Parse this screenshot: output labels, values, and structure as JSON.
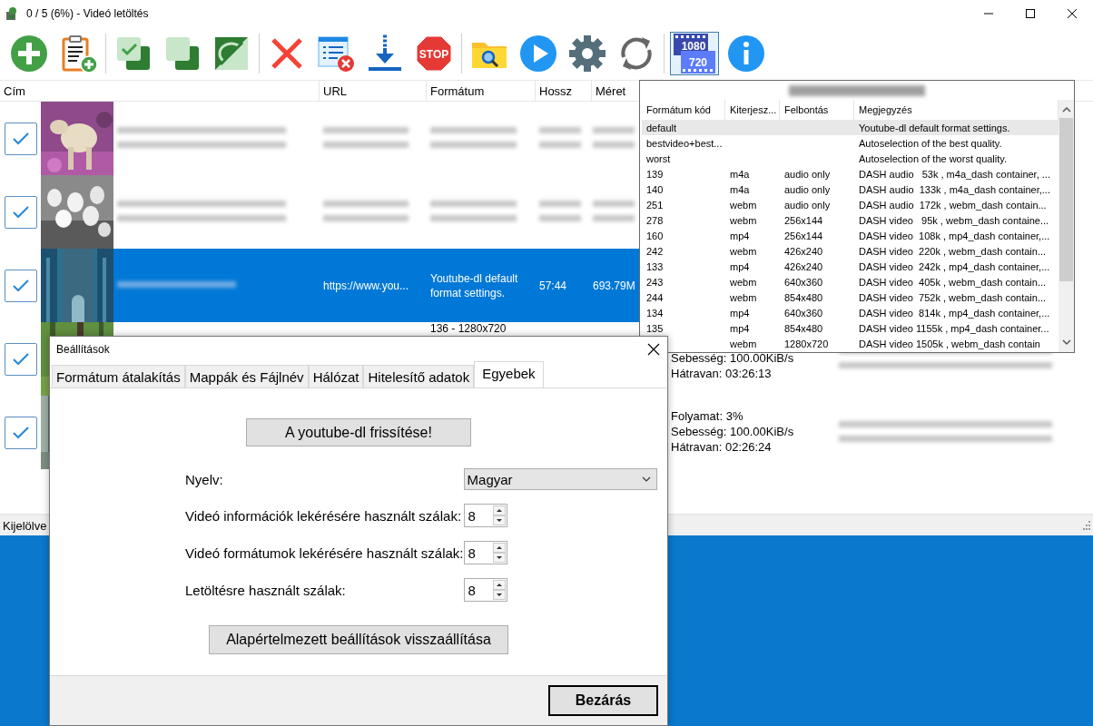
{
  "window": {
    "title": "0 / 5 (6%) - Videó letöltés"
  },
  "toolbar": [
    {
      "kind": "add",
      "selected": false
    },
    {
      "kind": "paste",
      "selected": false
    },
    {
      "kind": "sep"
    },
    {
      "kind": "checkall",
      "selected": false
    },
    {
      "kind": "uncheckall",
      "selected": false
    },
    {
      "kind": "invert",
      "selected": false
    },
    {
      "kind": "sep"
    },
    {
      "kind": "delete",
      "selected": false
    },
    {
      "kind": "removelist",
      "selected": false
    },
    {
      "kind": "download",
      "selected": false
    },
    {
      "kind": "stop",
      "label": "STOP",
      "selected": false
    },
    {
      "kind": "sep"
    },
    {
      "kind": "folder",
      "selected": false
    },
    {
      "kind": "play",
      "selected": false
    },
    {
      "kind": "settings",
      "selected": false
    },
    {
      "kind": "refresh",
      "selected": false
    },
    {
      "kind": "sep"
    },
    {
      "kind": "quality",
      "labels": [
        "1080",
        "720"
      ],
      "selected": true
    },
    {
      "kind": "info",
      "selected": false
    }
  ],
  "table": {
    "columns": [
      "Cím",
      "URL",
      "Formátum",
      "Hossz",
      "Méret"
    ],
    "rows": [
      {
        "checked": true,
        "selected": false,
        "cells": [
          {
            "kind": "redacted"
          },
          {
            "kind": "redacted"
          },
          {
            "kind": "redacted"
          },
          {
            "kind": "redacted"
          },
          {
            "kind": "redacted"
          }
        ]
      },
      {
        "checked": true,
        "selected": false,
        "cells": [
          {
            "kind": "redacted"
          },
          {
            "kind": "redacted"
          },
          {
            "kind": "redacted"
          },
          {
            "kind": "redacted"
          },
          {
            "kind": "redacted"
          }
        ]
      },
      {
        "checked": true,
        "selected": true,
        "cells": [
          {
            "kind": "redacted"
          },
          {
            "kind": "text",
            "text": "https://www.you..."
          },
          {
            "kind": "text",
            "text": "Youtube-dl default format settings."
          },
          {
            "kind": "text",
            "text": "57:44"
          },
          {
            "kind": "text",
            "text": "693.79M"
          }
        ]
      },
      {
        "checked": true,
        "selected": false,
        "cells": [
          {
            "kind": "empty"
          },
          {
            "kind": "empty"
          },
          {
            "kind": "text",
            "text": "136 - 1280x720"
          },
          {
            "kind": "empty"
          },
          {
            "kind": "empty"
          },
          {
            "kind": "lines",
            "lines": [
              "Sebesség: 100.00KiB/s",
              "Hátravan: 03:26:13"
            ]
          },
          {
            "kind": "redacted"
          }
        ]
      },
      {
        "checked": true,
        "selected": false,
        "cells": [
          {
            "kind": "empty"
          },
          {
            "kind": "empty"
          },
          {
            "kind": "empty"
          },
          {
            "kind": "empty"
          },
          {
            "kind": "empty"
          },
          {
            "kind": "lines",
            "lines": [
              "Folyamat: 3%",
              "Sebesség: 100.00KiB/s",
              "Hátravan: 02:26:24"
            ]
          },
          {
            "kind": "redacted"
          }
        ]
      }
    ]
  },
  "status_bar": {
    "text": "Kijelölve"
  },
  "format_popup": {
    "columns": [
      "Formátum kód",
      "Kiterjesz...",
      "Felbontás",
      "Megjegyzés"
    ],
    "rows": [
      {
        "code": "default",
        "note": "Youtube-dl default format settings.",
        "selected": true
      },
      {
        "code": "bestvideo+best...",
        "note": "Autoselection of the best quality.",
        "selected": false
      },
      {
        "code": "worst",
        "note": "Autoselection of the worst quality.",
        "selected": false
      },
      {
        "code": "139",
        "ext": "m4a",
        "resolution": "audio only",
        "note": "DASH audio   53k , m4a_dash container, ...",
        "selected": false
      },
      {
        "code": "140",
        "ext": "m4a",
        "resolution": "audio only",
        "note": "DASH audio  133k , m4a_dash container,...",
        "selected": false
      },
      {
        "code": "251",
        "ext": "webm",
        "resolution": "audio only",
        "note": "DASH audio  172k , webm_dash contain...",
        "selected": false
      },
      {
        "code": "278",
        "ext": "webm",
        "resolution": "256x144",
        "note": "DASH video   95k , webm_dash containe...",
        "selected": false
      },
      {
        "code": "160",
        "ext": "mp4",
        "resolution": "256x144",
        "note": "DASH video  108k , mp4_dash container,...",
        "selected": false
      },
      {
        "code": "242",
        "ext": "webm",
        "resolution": "426x240",
        "note": "DASH video  220k , webm_dash contain...",
        "selected": false
      },
      {
        "code": "133",
        "ext": "mp4",
        "resolution": "426x240",
        "note": "DASH video  242k , mp4_dash container,...",
        "selected": false
      },
      {
        "code": "243",
        "ext": "webm",
        "resolution": "640x360",
        "note": "DASH video  405k , webm_dash contain...",
        "selected": false
      },
      {
        "code": "244",
        "ext": "webm",
        "resolution": "854x480",
        "note": "DASH video  752k , webm_dash contain...",
        "selected": false
      },
      {
        "code": "134",
        "ext": "mp4",
        "resolution": "640x360",
        "note": "DASH video  814k , mp4_dash container,...",
        "selected": false
      },
      {
        "code": "135",
        "ext": "mp4",
        "resolution": "854x480",
        "note": "DASH video 1155k , mp4_dash container...",
        "selected": false
      },
      {
        "ext": "webm",
        "resolution": "1280x720",
        "note": "DASH video 1505k , webm_dash contain",
        "selected": false
      }
    ]
  },
  "dialog": {
    "title": "Beállítások",
    "tabs": [
      {
        "label": "Formátum átalakítás",
        "selected": false
      },
      {
        "label": "Mappák és Fájlnév",
        "selected": false
      },
      {
        "label": "Hálózat",
        "selected": false
      },
      {
        "label": "Hitelesítő adatok",
        "selected": false
      },
      {
        "label": "Egyebek",
        "selected": true
      }
    ],
    "update_button": "A youtube-dl frissítése!",
    "language": {
      "label": "Nyelv:",
      "value": "Magyar"
    },
    "spinners": [
      {
        "label": "Videó információk lekérésére használt szálak:",
        "value": "8"
      },
      {
        "label": "Videó formátumok lekérésére használt szálak:",
        "value": "8"
      },
      {
        "label": "Letöltésre használt szálak:",
        "value": "8"
      }
    ],
    "reset_button": "Alapértelmezett beállítások visszaállítása",
    "close_button": "Bezárás"
  }
}
